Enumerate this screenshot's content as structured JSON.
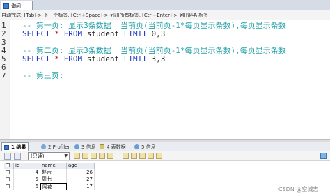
{
  "query_tab": {
    "label": "询问"
  },
  "hint_bar": {
    "text": "自动完成: [Tab]-> 下一个标签, [Ctrl+Space]-> 列出所有标签, [Ctrl+Enter]-> 列出匹配标签"
  },
  "editor": {
    "lines": [
      {
        "no": "1",
        "parts": [
          {
            "t": "-- 第一页: 显示3条数据  当前页(当前页-1*每页显示条数),每页显示条数",
            "c": "cm"
          }
        ]
      },
      {
        "no": "2",
        "parts": [
          {
            "t": "SELECT ",
            "c": "kw"
          },
          {
            "t": "*",
            "c": "op"
          },
          {
            "t": " FROM ",
            "c": "kw"
          },
          {
            "t": "student ",
            "c": "id"
          },
          {
            "t": "LIMIT ",
            "c": "kw"
          },
          {
            "t": "0,3",
            "c": "nm"
          }
        ]
      },
      {
        "no": "3",
        "parts": []
      },
      {
        "no": "4",
        "parts": [
          {
            "t": "-- 第二页: 显示3条数据  当前页(当前页-1*每页显示条数),每页显示条数",
            "c": "cm"
          }
        ]
      },
      {
        "no": "5",
        "parts": [
          {
            "t": "SELECT ",
            "c": "kw"
          },
          {
            "t": "*",
            "c": "op"
          },
          {
            "t": " FROM ",
            "c": "kw"
          },
          {
            "t": "student ",
            "c": "id"
          },
          {
            "t": "LIMIT ",
            "c": "kw"
          },
          {
            "t": "3,3",
            "c": "nm"
          }
        ]
      },
      {
        "no": "6",
        "parts": []
      },
      {
        "no": "7",
        "parts": [
          {
            "t": "-- 第三页:",
            "c": "cm"
          }
        ]
      }
    ]
  },
  "result_tabs": [
    {
      "label": "1 结果",
      "icon": "grid-icon",
      "active": true
    },
    {
      "label": "2 Profiler",
      "icon": "profiler-icon",
      "active": false
    },
    {
      "label": "3 信息",
      "icon": "info-icon",
      "active": false
    },
    {
      "label": "4 表数据",
      "icon": "table-data-icon",
      "active": false
    },
    {
      "label": "5 信息",
      "icon": "info-icon",
      "active": false
    }
  ],
  "result_toolbar": {
    "mode_value": "(只读)"
  },
  "result_grid": {
    "columns": [
      "id",
      "name",
      "age"
    ],
    "rows": [
      [
        "4",
        "赵六",
        "26"
      ],
      [
        "5",
        "周七",
        "27"
      ],
      [
        "6",
        "阿花",
        "17"
      ]
    ]
  },
  "watermark": {
    "text": "CSDN @空城志"
  },
  "colors": {
    "comment": "#24a0a6",
    "keyword": "#2436c8",
    "operator": "#c81818"
  }
}
